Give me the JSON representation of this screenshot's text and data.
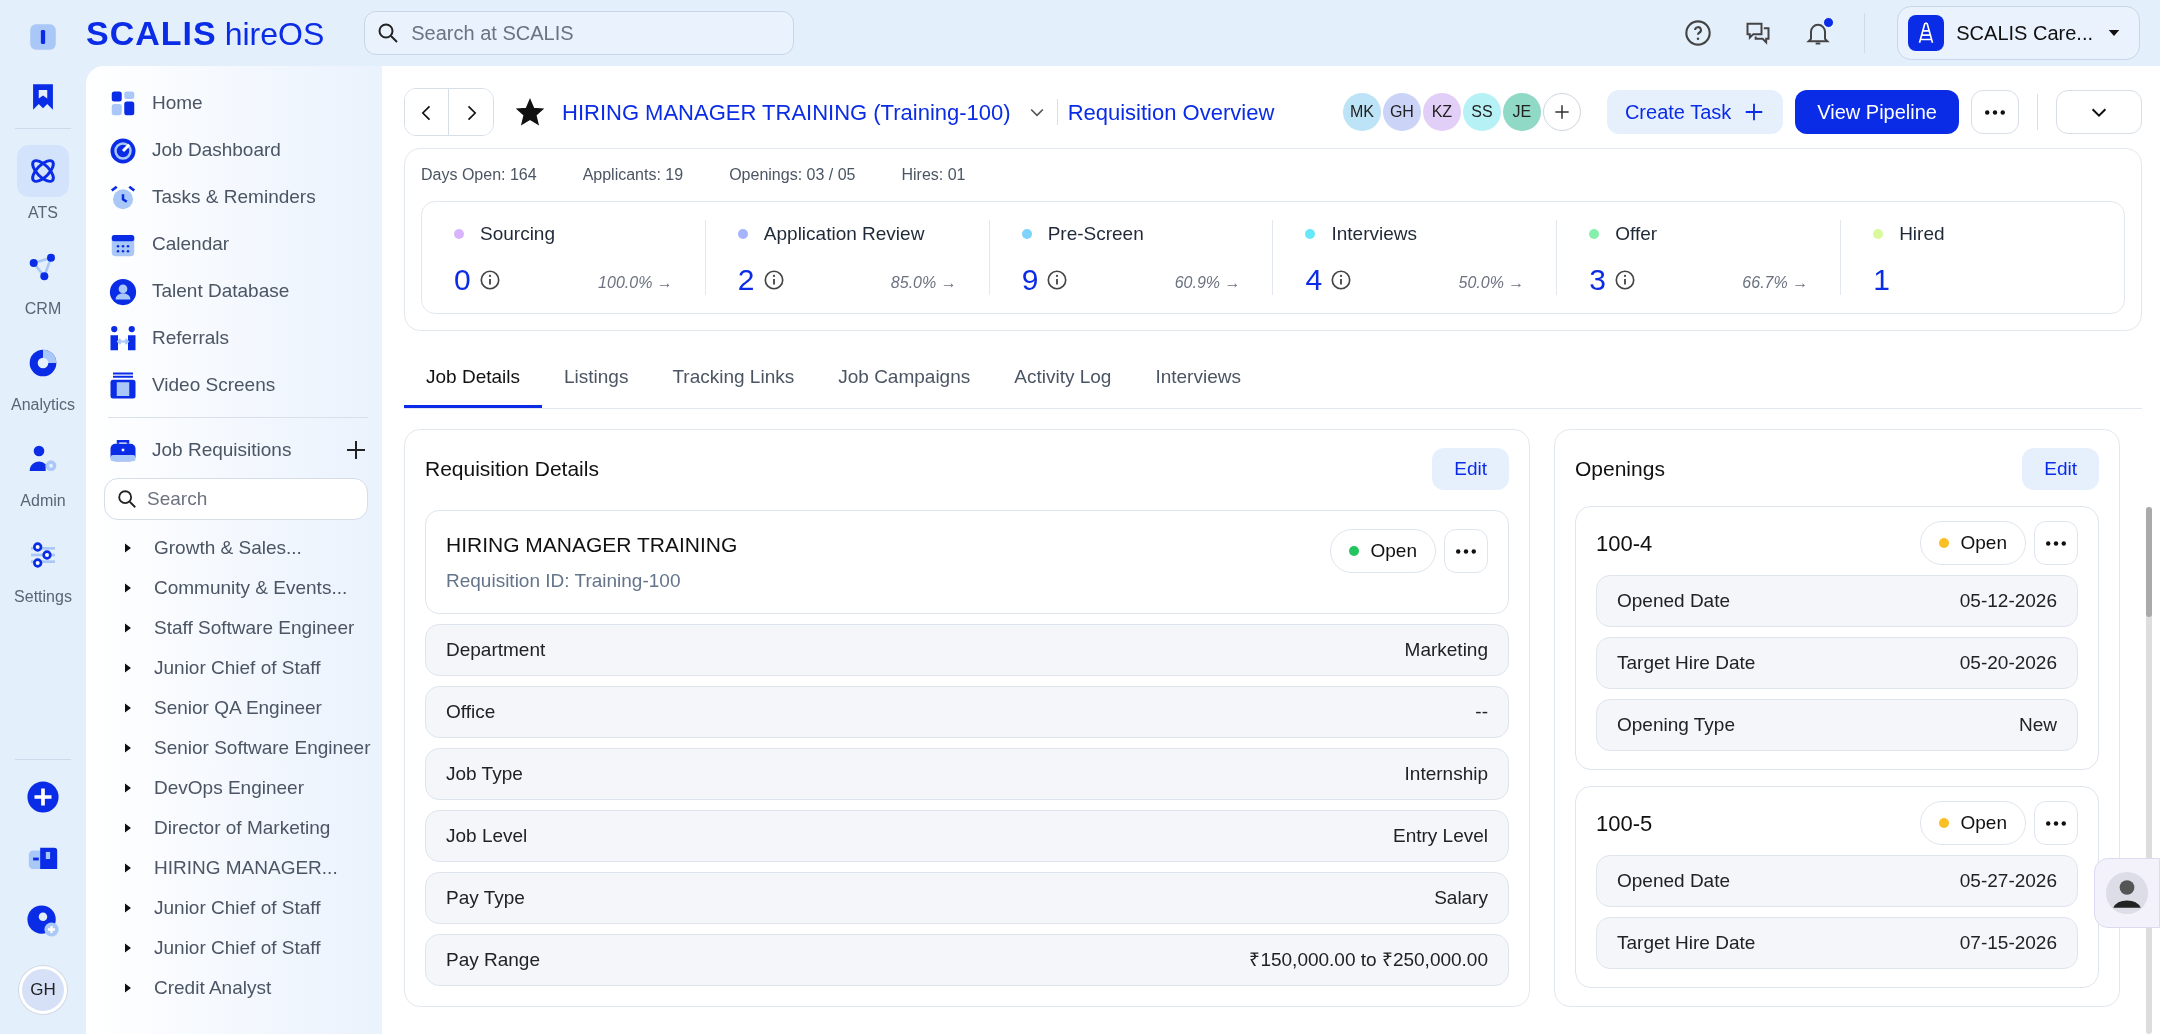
{
  "brand": {
    "name": "SCALIS",
    "product": "hireOS"
  },
  "search": {
    "placeholder": "Search at SCALIS"
  },
  "topbar": {
    "has_unread": true,
    "account": "SCALIS Care..."
  },
  "rail": {
    "items": [
      {
        "label": "ATS",
        "selected": true
      },
      {
        "label": "CRM",
        "selected": false
      },
      {
        "label": "Analytics",
        "selected": false
      },
      {
        "label": "Admin",
        "selected": false
      },
      {
        "label": "Settings",
        "selected": false
      }
    ],
    "user_initials": "GH"
  },
  "nav": {
    "items": [
      {
        "label": "Home"
      },
      {
        "label": "Job Dashboard"
      },
      {
        "label": "Tasks & Reminders"
      },
      {
        "label": "Calendar"
      },
      {
        "label": "Talent Database"
      },
      {
        "label": "Referrals"
      },
      {
        "label": "Video Screens"
      }
    ],
    "requisitions_title": "Job Requisitions",
    "requisitions_search": {
      "placeholder": "Search"
    },
    "requisitions": [
      {
        "label": "Growth & Sales...",
        "expanded": false
      },
      {
        "label": "Community & Events...",
        "expanded": false
      },
      {
        "label": "Staff Software Engineer",
        "expanded": false
      },
      {
        "label": "Junior Chief of Staff",
        "expanded": false
      },
      {
        "label": "Senior QA Engineer",
        "expanded": false
      },
      {
        "label": "Senior Software Engineer",
        "expanded": false
      },
      {
        "label": "DevOps Engineer",
        "expanded": false
      },
      {
        "label": "Director of Marketing",
        "expanded": false
      },
      {
        "label": "HIRING MANAGER...",
        "expanded": false
      },
      {
        "label": "Junior Chief of Staff",
        "expanded": false
      },
      {
        "label": "Junior Chief of Staff",
        "expanded": false
      },
      {
        "label": "Credit Analyst",
        "expanded": false
      }
    ]
  },
  "header": {
    "favorite": true,
    "title": "HIRING MANAGER TRAINING (Training-100)",
    "subtitle": "Requisition Overview",
    "collaborators": [
      {
        "initials": "MK",
        "color": "#bde3f6"
      },
      {
        "initials": "GH",
        "color": "#cbd4f6"
      },
      {
        "initials": "KZ",
        "color": "#e2cff8"
      },
      {
        "initials": "SS",
        "color": "#b6f1f6"
      },
      {
        "initials": "JE",
        "color": "#8fd9c6"
      }
    ],
    "create_task": "Create Task",
    "view_pipeline": "View Pipeline"
  },
  "stats": [
    {
      "label": "Days Open:",
      "value": "164"
    },
    {
      "label": "Applicants:",
      "value": "19"
    },
    {
      "label": "Openings:",
      "value": "03 / 05"
    },
    {
      "label": "Hires:",
      "value": "01"
    }
  ],
  "stages": [
    {
      "name": "Sourcing",
      "color": "#d8b4fe",
      "count": "0",
      "rate": "100.0% →"
    },
    {
      "name": "Application Review",
      "color": "#a5b4fc",
      "count": "2",
      "rate": "85.0% →"
    },
    {
      "name": "Pre-Screen",
      "color": "#7dd3fc",
      "count": "9",
      "rate": "60.9% →"
    },
    {
      "name": "Interviews",
      "color": "#67e8f9",
      "count": "4",
      "rate": "50.0% →"
    },
    {
      "name": "Offer",
      "color": "#86efac",
      "count": "3",
      "rate": "66.7% →"
    },
    {
      "name": "Hired",
      "color": "#d9f99d",
      "count": "1"
    }
  ],
  "tabs": [
    {
      "label": "Job Details",
      "selected": true
    },
    {
      "label": "Listings",
      "selected": false
    },
    {
      "label": "Tracking Links",
      "selected": false
    },
    {
      "label": "Job Campaigns",
      "selected": false
    },
    {
      "label": "Activity Log",
      "selected": false
    },
    {
      "label": "Interviews",
      "selected": false
    }
  ],
  "requisition": {
    "title": "Requisition Details",
    "edit": "Edit",
    "name": "HIRING MANAGER TRAINING",
    "id_line": "Requisition ID: Training-100",
    "status": {
      "label": "Open",
      "color": "#22c55e"
    },
    "fields": [
      {
        "label": "Department",
        "value": "Marketing"
      },
      {
        "label": "Office",
        "value": "--"
      },
      {
        "label": "Job Type",
        "value": "Internship"
      },
      {
        "label": "Job Level",
        "value": "Entry Level"
      },
      {
        "label": "Pay Type",
        "value": "Salary"
      },
      {
        "label": "Pay Range",
        "value": "₹150,000.00 to ₹250,000.00"
      }
    ]
  },
  "openings": {
    "title": "Openings",
    "edit": "Edit",
    "items": [
      {
        "id": "100-4",
        "status": {
          "label": "Open",
          "color": "#fbbf24"
        },
        "fields": [
          {
            "label": "Opened Date",
            "value": "05-12-2026"
          },
          {
            "label": "Target Hire Date",
            "value": "05-20-2026"
          },
          {
            "label": "Opening Type",
            "value": "New"
          }
        ]
      },
      {
        "id": "100-5",
        "status": {
          "label": "Open",
          "color": "#fbbf24"
        },
        "fields": [
          {
            "label": "Opened Date",
            "value": "05-27-2026"
          },
          {
            "label": "Target Hire Date",
            "value": "07-15-2026"
          }
        ]
      }
    ]
  }
}
